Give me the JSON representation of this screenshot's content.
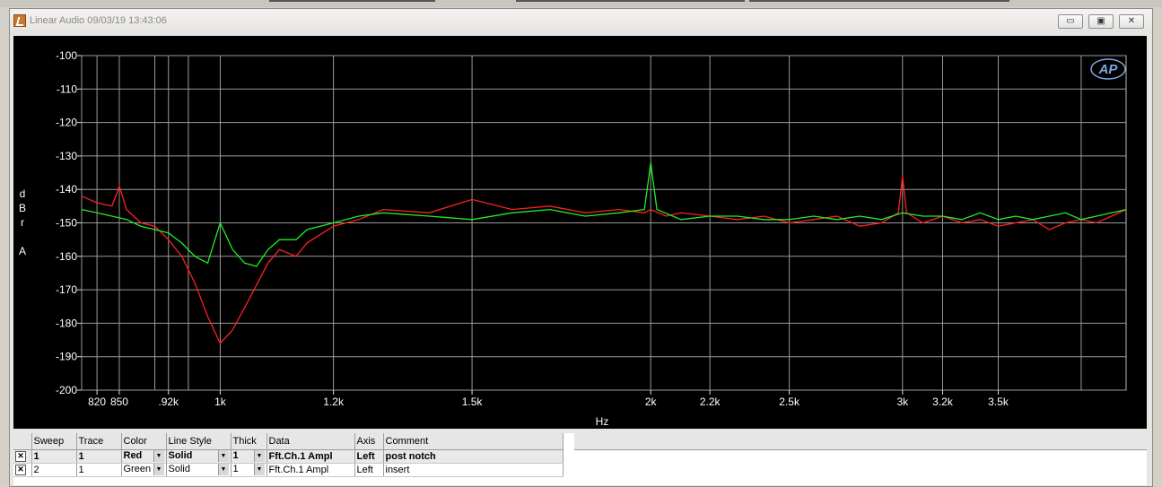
{
  "window": {
    "title": "Linear Audio  09/03/19 13:43:06",
    "buttons": {
      "minimize": "▭",
      "restore": "▣",
      "close": "✕"
    }
  },
  "logo": "AP",
  "chart_data": {
    "type": "line",
    "xscale": "log",
    "xlim": [
      800,
      4300
    ],
    "ylim": [
      -200,
      -100
    ],
    "grid": true,
    "xlabel": "Hz",
    "ylabel_lines": [
      "d",
      "B",
      "r",
      "",
      "A"
    ],
    "yticks": [
      -100,
      -110,
      -120,
      -130,
      -140,
      -150,
      -160,
      -170,
      -180,
      -190,
      -200
    ],
    "xticks": [
      {
        "v": 820,
        "label": "820"
      },
      {
        "v": 850,
        "label": "850"
      },
      {
        "v": 920,
        "label": ".92k"
      },
      {
        "v": 1000,
        "label": "1k"
      },
      {
        "v": 1200,
        "label": "1.2k"
      },
      {
        "v": 1500,
        "label": "1.5k"
      },
      {
        "v": 2000,
        "label": "2k"
      },
      {
        "v": 2200,
        "label": "2.2k"
      },
      {
        "v": 2500,
        "label": "2.5k"
      },
      {
        "v": 3000,
        "label": "3k"
      },
      {
        "v": 3200,
        "label": "3.2k"
      },
      {
        "v": 3500,
        "label": "3.5k"
      }
    ],
    "minor_gridlines": [
      800,
      820,
      850,
      900,
      920,
      950,
      1000,
      1200,
      1500,
      2000,
      2200,
      2500,
      3000,
      3200,
      3500,
      4000
    ],
    "series": [
      {
        "color": "#ff2020",
        "x": [
          800,
          820,
          840,
          850,
          860,
          880,
          900,
          920,
          940,
          960,
          980,
          1000,
          1020,
          1050,
          1080,
          1100,
          1130,
          1150,
          1200,
          1250,
          1300,
          1400,
          1500,
          1600,
          1700,
          1800,
          1900,
          1980,
          2000,
          2050,
          2100,
          2200,
          2300,
          2400,
          2500,
          2600,
          2700,
          2800,
          2900,
          2980,
          3000,
          3020,
          3100,
          3200,
          3300,
          3400,
          3500,
          3600,
          3700,
          3800,
          3900,
          4000,
          4100,
          4200,
          4300
        ],
        "y": [
          -142,
          -144,
          -145,
          -139,
          -146,
          -150,
          -151,
          -155,
          -160,
          -168,
          -178,
          -186,
          -182,
          -172,
          -162,
          -158,
          -160,
          -156,
          -151,
          -149,
          -146,
          -147,
          -143,
          -146,
          -145,
          -147,
          -146,
          -147,
          -146,
          -148,
          -147,
          -148,
          -149,
          -148,
          -150,
          -149,
          -148,
          -151,
          -150,
          -147,
          -136,
          -147,
          -150,
          -148,
          -150,
          -149,
          -151,
          -150,
          -149,
          -152,
          -150,
          -149,
          -150,
          -148,
          -146
        ]
      },
      {
        "color": "#22ee22",
        "x": [
          800,
          820,
          840,
          860,
          880,
          900,
          920,
          940,
          960,
          980,
          1000,
          1020,
          1040,
          1060,
          1080,
          1100,
          1130,
          1150,
          1200,
          1250,
          1300,
          1400,
          1500,
          1600,
          1700,
          1800,
          1900,
          1980,
          2000,
          2020,
          2100,
          2200,
          2300,
          2400,
          2500,
          2600,
          2700,
          2800,
          2900,
          3000,
          3100,
          3200,
          3300,
          3400,
          3500,
          3600,
          3700,
          3800,
          3900,
          4000,
          4100,
          4200,
          4300
        ],
        "y": [
          -146,
          -147,
          -148,
          -149,
          -151,
          -152,
          -153,
          -156,
          -160,
          -162,
          -150,
          -158,
          -162,
          -163,
          -158,
          -155,
          -155,
          -152,
          -150,
          -148,
          -147,
          -148,
          -149,
          -147,
          -146,
          -148,
          -147,
          -146,
          -132,
          -146,
          -149,
          -148,
          -148,
          -149,
          -149,
          -148,
          -149,
          -148,
          -149,
          -147,
          -148,
          -148,
          -149,
          -147,
          -149,
          -148,
          -149,
          -148,
          -147,
          -149,
          -148,
          -147,
          -146
        ]
      }
    ]
  },
  "table": {
    "headers": [
      "Sweep",
      "Trace",
      "Color",
      "Line Style",
      "Thick",
      "Data",
      "Axis",
      "Comment"
    ],
    "rows": [
      {
        "checked": "✕",
        "sweep": "1",
        "trace": "1",
        "color": "Red",
        "style": "Solid",
        "thick": "1",
        "data": "Fft.Ch.1 Ampl",
        "axis": "Left",
        "comment": "post notch"
      },
      {
        "checked": "✕",
        "sweep": "2",
        "trace": "1",
        "color": "Green",
        "style": "Solid",
        "thick": "1",
        "data": "Fft.Ch.1 Ampl",
        "axis": "Left",
        "comment": "insert"
      }
    ]
  }
}
